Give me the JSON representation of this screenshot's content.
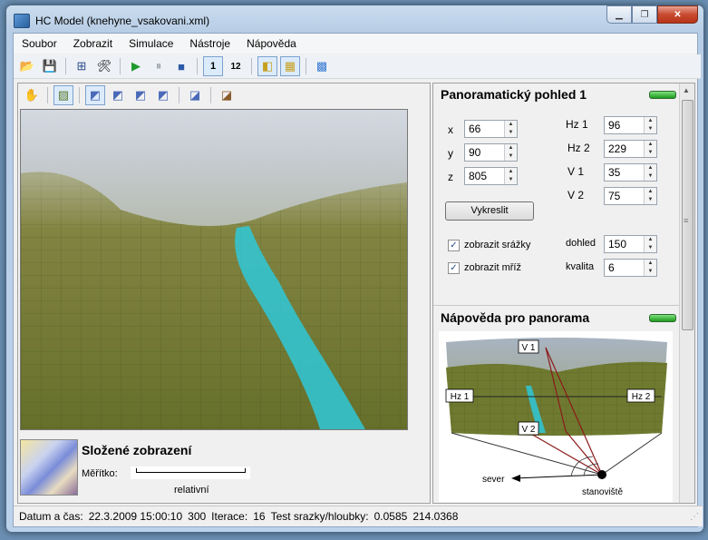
{
  "window": {
    "title": "HC Model (knehyne_vsakovani.xml)"
  },
  "menu": [
    "Soubor",
    "Zobrazit",
    "Simulace",
    "Nástroje",
    "Nápověda"
  ],
  "legend": {
    "title": "Složené zobrazení",
    "scale_label": "Měřítko:",
    "scale_value": "relativní"
  },
  "panorama": {
    "header": "Panoramatický pohled 1",
    "x_label": "x",
    "x": "66",
    "y_label": "y",
    "y": "90",
    "z_label": "z",
    "z": "805",
    "hz1_label": "Hz 1",
    "hz1": "96",
    "hz2_label": "Hz 2",
    "hz2": "229",
    "v1_label": "V 1",
    "v1": "35",
    "v2_label": "V 2",
    "v2": "75",
    "draw_button": "Vykreslit",
    "show_rain": "zobrazit srážky",
    "show_grid": "zobrazit mříž",
    "view_label": "dohled",
    "view": "150",
    "quality_label": "kvalita",
    "quality": "6"
  },
  "help": {
    "header": "Nápověda pro panorama",
    "v1": "V 1",
    "v2": "V 2",
    "hz1": "Hz 1",
    "hz2": "Hz 2",
    "north": "sever",
    "station": "stanoviště"
  },
  "status": {
    "date_label": "Datum a čas:",
    "date": "22.3.2009 15:00:10",
    "seconds": "300",
    "iter_label": "Iterace:",
    "iter": "16",
    "test_label": "Test srazky/hloubky:",
    "test1": "0.0585",
    "test2": "214.0368"
  },
  "colors": {
    "terrain": "#6f7a2c",
    "water": "#2fc8d8",
    "led": "#1d9a1d"
  }
}
